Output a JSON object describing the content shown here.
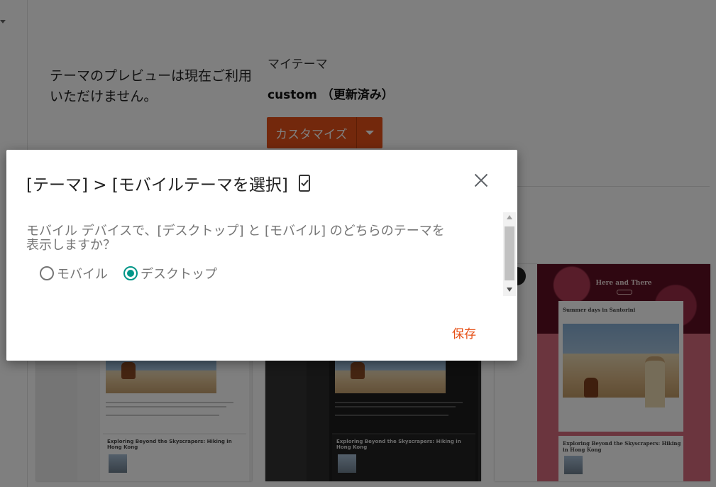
{
  "background": {
    "preview_unavailable": "テーマのプレビューは現在ご利用いただけません。",
    "my_theme_label": "マイテーマ",
    "theme_name": "custom （更新済み）",
    "customize_button": "カスタマイズ",
    "accent_color": "#e65118"
  },
  "theme_cards": [
    {
      "post_title": "Exploring Beyond the Skyscrapers: Hiking in Hong Kong"
    },
    {
      "post_title": "Exploring Beyond the Skyscrapers: Hiking in Hong Kong"
    },
    {
      "blog_title": "Here and There",
      "post_title_1": "Summer days in Santorini",
      "post_title_2": "Exploring Beyond the Skyscrapers: Hiking in Hong Kong"
    }
  ],
  "dialog": {
    "title": "[テーマ] > [モバイルテーマを選択]",
    "question": "モバイル デバイスで、[デスクトップ] と [モバイル] のどちらのテーマを表示しますか？",
    "options": [
      {
        "label": "モバイル",
        "selected": false
      },
      {
        "label": "デスクトップ",
        "selected": true
      }
    ],
    "save_label": "保存",
    "radio_color": "#009688"
  }
}
